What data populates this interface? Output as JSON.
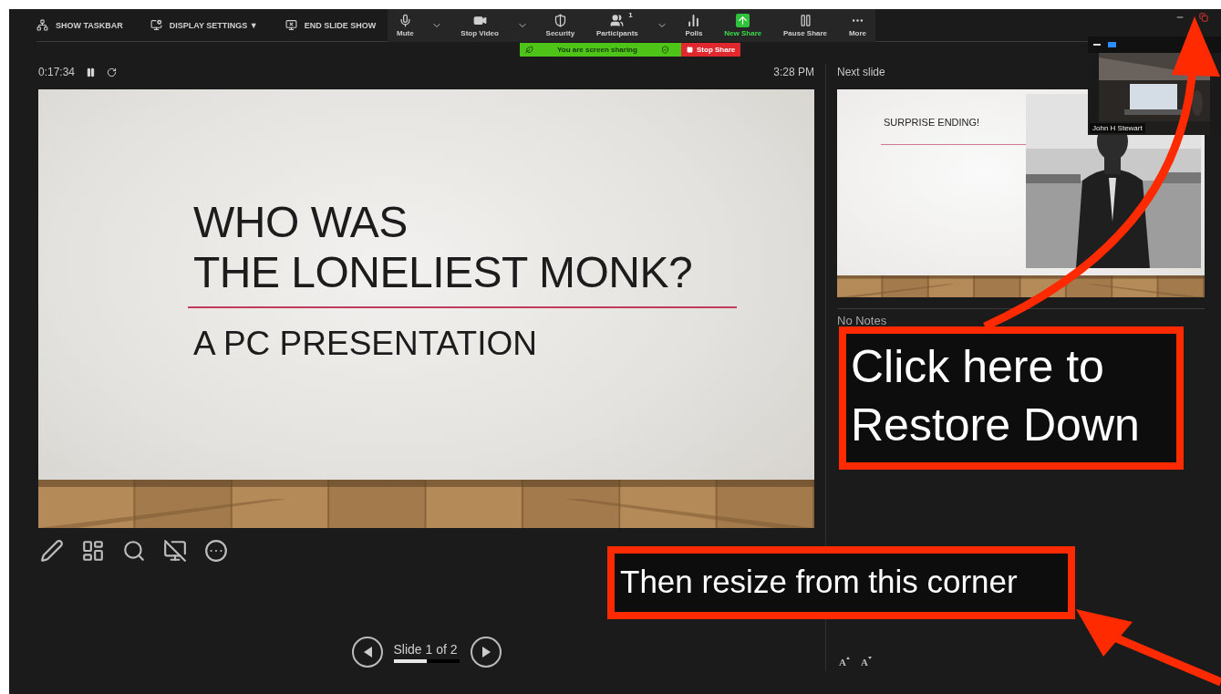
{
  "presenter_toolbar": [
    {
      "label": "SHOW TASKBAR",
      "kind": "taskbar"
    },
    {
      "label": "DISPLAY SETTINGS ▼",
      "kind": "display"
    },
    {
      "label": "END SLIDE SHOW",
      "kind": "end"
    }
  ],
  "meeting_toolbar": [
    {
      "label": "Mute",
      "kind": "mic",
      "dropdown": true,
      "highlighted": false
    },
    {
      "label": "Stop Video",
      "kind": "video",
      "dropdown": true,
      "highlighted": false
    },
    {
      "label": "Security",
      "kind": "shield",
      "dropdown": false,
      "highlighted": false
    },
    {
      "label": "Participants",
      "kind": "people",
      "badge": "1",
      "dropdown": true,
      "highlighted": false
    },
    {
      "label": "Polls",
      "kind": "polls",
      "dropdown": false,
      "highlighted": false
    },
    {
      "label": "New Share",
      "kind": "share",
      "dropdown": false,
      "highlighted": true
    },
    {
      "label": "Pause Share",
      "kind": "pause",
      "dropdown": false,
      "highlighted": false
    },
    {
      "label": "More",
      "kind": "more",
      "dropdown": false,
      "highlighted": false
    }
  ],
  "sharing_banner": {
    "status": "You are screen sharing",
    "stop_label": "Stop Share"
  },
  "presenter": {
    "timer": "0:17:34",
    "clock": "3:28 PM",
    "slide": {
      "title_lines": [
        "WHO WAS",
        "THE LONELIEST MONK?"
      ],
      "subtitle": "A PC PRESENTATION"
    },
    "tools": [
      {
        "kind": "pen"
      },
      {
        "kind": "slides"
      },
      {
        "kind": "zoom"
      },
      {
        "kind": "blackout"
      },
      {
        "kind": "more"
      }
    ],
    "navigation": {
      "label": "Slide 1 of 2",
      "level": 0.5
    }
  },
  "next_slide": {
    "heading": "Next slide",
    "title": "SURPRISE ENDING!"
  },
  "notes": {
    "text": "No Notes"
  },
  "font_controls": [
    {
      "label": "A",
      "kind": "increase"
    },
    {
      "label": "A",
      "kind": "decrease"
    }
  ],
  "video_tile": {
    "name": "John H Stewart"
  },
  "annotations": [
    {
      "text": "Click here to Restore Down",
      "kind": "restore"
    },
    {
      "text": "Then resize from this corner",
      "kind": "resize"
    }
  ]
}
